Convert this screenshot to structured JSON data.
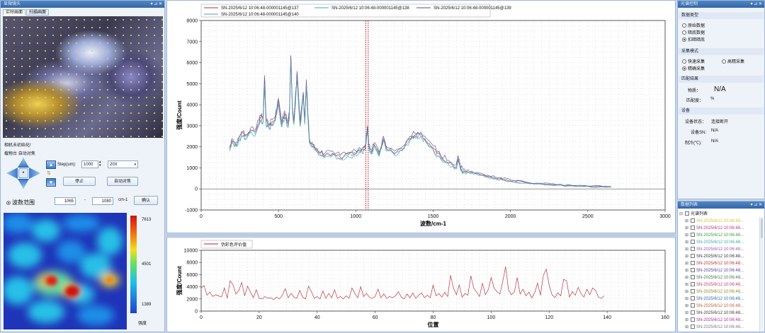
{
  "left": {
    "camera_title": "显微镜头",
    "tabs": [
      "实时画面",
      "扫描画面"
    ],
    "camera_status": "相机未初始化!",
    "stage_tabs": [
      "载物台",
      "自动对焦"
    ],
    "step_label": "Step(um):",
    "step_value": "1000",
    "objective": "20X",
    "stop_button": "停止",
    "autofocus_button": "自动对焦",
    "wave_range_label": "波数范围",
    "range_from": "1065",
    "range_sep": "-",
    "range_to": "1080",
    "range_unit": "cm-1",
    "confirm_button": "确认",
    "colorbar_max": "7613",
    "colorbar_mid": "4501",
    "colorbar_min": "1389",
    "colorbar_title": "强度"
  },
  "right": {
    "control_title": "光谱控制",
    "data_type_title": "数据类型",
    "data_types": [
      "原始数据",
      "暗底数据",
      "扣暗暗底"
    ],
    "acq_mode_title": "采集模式",
    "acq_modes": [
      "快速采集",
      "高精采集",
      "精确采集"
    ],
    "match_title": "匹配结果",
    "substance_label": "物质：",
    "substance_value": "N/A",
    "match_label": "匹配度：",
    "match_unit": "%",
    "device_title": "设备",
    "device_status_label": "设备状态：",
    "device_status_value": "连接断开",
    "device_sn_label": "设备SN:",
    "device_sn_value": "N/A",
    "cooling_label": "制冷(℃):",
    "cooling_value": "N/A",
    "list_title": "数据列表",
    "list_root": "光谱列表",
    "list_items": [
      "SN-2025/6/12 10:06:48...",
      "SN-2025/6/12 10:06:48...",
      "SN-2025/6/12 10:06:48...",
      "SN-2025/6/12 10:06:48...",
      "SN-2025/6/12 10:06:48...",
      "SN-2025/6/12 10:06:48...",
      "SN-2025/6/12 10:06:48...",
      "SN-2025/6/12 10:06:48...",
      "SN-2025/6/12 10:06:48...",
      "SN-2025/6/12 10:06:48...",
      "SN-2025/6/12 10:06:48...",
      "SN-2025/6/12 10:06:48...",
      "SN-2025/6/12 10:06:48...",
      "SN-2025/6/12 10:06:48...",
      "SN-2025/6/12 10:06:48...",
      "SN-2025/6/12 10:06:48..."
    ],
    "list_colors": [
      "#d8c23a",
      "#c0307a",
      "#3a9a3a",
      "#3aa8b0",
      "#9a5ab8",
      "#333333",
      "#c03030",
      "#5a3a9a",
      "#3a7a3a",
      "#c03a7a",
      "#8a8a2a",
      "#2a6ab0",
      "#c06030",
      "#3a3a3a",
      "#b03090",
      "#7a7a7a"
    ],
    "colors": {
      "titlebar": "#3a6fb0",
      "panel_bg": "#f3f6fb",
      "accent": "#c01818"
    }
  },
  "chart_data": [
    {
      "type": "line",
      "xlabel": "波数/cm-1",
      "ylabel": "强度/Count",
      "xlim": [
        0,
        3000
      ],
      "ylim": [
        -1000,
        8000
      ],
      "xticks": [
        0,
        500,
        1000,
        1500,
        2000,
        2500,
        3000
      ],
      "yticks": [
        -1000,
        0,
        1000,
        2000,
        3000,
        4000,
        5000,
        6000,
        7000,
        8000
      ],
      "vlines": [
        1065,
        1080
      ],
      "legend_position": "top",
      "grid": true,
      "series": [
        {
          "name": "SN-2025/6/12 10:06:48-000001145@137",
          "color": "#a8324a",
          "shift": 0,
          "x": [
            185,
            200,
            230,
            260,
            290,
            320,
            350,
            380,
            400,
            410,
            420,
            440,
            460,
            480,
            500,
            520,
            540,
            560,
            570,
            580,
            590,
            600,
            620,
            640,
            660,
            670,
            680,
            690,
            700,
            720,
            760,
            800,
            850,
            900,
            950,
            1000,
            1030,
            1060,
            1075,
            1085,
            1100,
            1120,
            1150,
            1180,
            1200,
            1250,
            1300,
            1350,
            1380,
            1420,
            1450,
            1500,
            1550,
            1600,
            1650,
            1660,
            1680,
            1700,
            1750,
            1800,
            1850,
            1900,
            1950,
            2000,
            2100,
            2200,
            2300,
            2400,
            2500,
            2600,
            2650
          ],
          "y": [
            1900,
            2300,
            2100,
            2600,
            2500,
            2800,
            2700,
            3400,
            3300,
            5200,
            3200,
            3000,
            3200,
            3400,
            4200,
            3100,
            3600,
            3100,
            3500,
            6300,
            3800,
            3200,
            5500,
            3100,
            4500,
            3200,
            5100,
            3500,
            2300,
            2100,
            1700,
            1600,
            1700,
            1500,
            1650,
            1700,
            1800,
            1950,
            2900,
            2000,
            1750,
            2100,
            1650,
            2400,
            1900,
            1700,
            1900,
            2400,
            2550,
            2600,
            2350,
            1950,
            1500,
            1250,
            1050,
            1500,
            900,
            850,
            800,
            700,
            600,
            520,
            450,
            380,
            300,
            240,
            190,
            160,
            130,
            110,
            100
          ]
        },
        {
          "name": "SN-2025/6/12 10:06:48-000001145@138",
          "color": "#3aa8b0",
          "shift": -150,
          "x": [
            185,
            200,
            230,
            260,
            290,
            320,
            350,
            380,
            400,
            410,
            420,
            440,
            460,
            480,
            500,
            520,
            540,
            560,
            570,
            580,
            590,
            600,
            620,
            640,
            660,
            670,
            680,
            690,
            700,
            720,
            760,
            800,
            850,
            900,
            950,
            1000,
            1030,
            1060,
            1075,
            1085,
            1100,
            1120,
            1150,
            1180,
            1200,
            1250,
            1300,
            1350,
            1380,
            1420,
            1450,
            1500,
            1550,
            1600,
            1650,
            1660,
            1680,
            1700,
            1750,
            1800,
            1850,
            1900,
            1950,
            2000,
            2100,
            2200,
            2300,
            2400,
            2500,
            2600,
            2650
          ],
          "y": [
            1800,
            2200,
            2000,
            2500,
            2350,
            2650,
            2550,
            3200,
            3100,
            4900,
            3000,
            2850,
            3050,
            3250,
            4000,
            2950,
            3400,
            2950,
            3300,
            6000,
            3600,
            3050,
            5200,
            2950,
            4300,
            3050,
            4900,
            3300,
            2200,
            2000,
            1600,
            1500,
            1600,
            1400,
            1550,
            1600,
            1700,
            1850,
            2750,
            1900,
            1650,
            2000,
            1550,
            2300,
            1800,
            1600,
            1800,
            2300,
            2450,
            2500,
            2250,
            1850,
            1400,
            1150,
            950,
            1400,
            850,
            800,
            750,
            650,
            560,
            480,
            420,
            350,
            280,
            220,
            170,
            140,
            120,
            100,
            90
          ]
        },
        {
          "name": "SN-2025/6/12 10:06:48-000001145@139",
          "color": "#5a4aa0",
          "shift": 100,
          "x": [
            185,
            200,
            230,
            260,
            290,
            320,
            350,
            380,
            400,
            410,
            420,
            440,
            460,
            480,
            500,
            520,
            540,
            560,
            570,
            580,
            590,
            600,
            620,
            640,
            660,
            670,
            680,
            690,
            700,
            720,
            760,
            800,
            850,
            900,
            950,
            1000,
            1030,
            1060,
            1075,
            1085,
            1100,
            1120,
            1150,
            1180,
            1200,
            1250,
            1300,
            1350,
            1380,
            1420,
            1450,
            1500,
            1550,
            1600,
            1650,
            1660,
            1680,
            1700,
            1750,
            1800,
            1850,
            1900,
            1950,
            2000,
            2100,
            2200,
            2300,
            2400,
            2500,
            2600,
            2650
          ],
          "y": [
            2000,
            2400,
            2200,
            2700,
            2600,
            2900,
            2800,
            3500,
            3400,
            5400,
            3300,
            3100,
            3300,
            3500,
            4300,
            3200,
            3700,
            3200,
            3600,
            6350,
            3900,
            3300,
            5600,
            3200,
            4600,
            3300,
            5200,
            3600,
            2400,
            2200,
            1800,
            1700,
            1800,
            1600,
            1750,
            1800,
            1900,
            2050,
            3000,
            2100,
            1850,
            2200,
            1750,
            2500,
            2000,
            1800,
            2000,
            2500,
            2650,
            2700,
            2450,
            2050,
            1600,
            1350,
            1150,
            1600,
            1000,
            950,
            850,
            750,
            650,
            570,
            500,
            420,
            330,
            260,
            210,
            170,
            140,
            120,
            110
          ]
        },
        {
          "name": "SN-2025/6/12 10:06:48-000001145@140",
          "color": "#5a9aa8",
          "shift": -80,
          "x": [
            185,
            200,
            230,
            260,
            290,
            320,
            350,
            380,
            400,
            410,
            420,
            440,
            460,
            480,
            500,
            520,
            540,
            560,
            570,
            580,
            590,
            600,
            620,
            640,
            660,
            670,
            680,
            690,
            700,
            720,
            760,
            800,
            850,
            900,
            950,
            1000,
            1030,
            1060,
            1075,
            1085,
            1100,
            1120,
            1150,
            1180,
            1200,
            1250,
            1300,
            1350,
            1380,
            1420,
            1450,
            1500,
            1550,
            1600,
            1650,
            1660,
            1680,
            1700,
            1750,
            1800,
            1850,
            1900,
            1950,
            2000,
            2100,
            2200,
            2300,
            2400,
            2500,
            2600,
            2650
          ],
          "y": [
            1850,
            2250,
            2050,
            2550,
            2400,
            2700,
            2600,
            3300,
            3200,
            5000,
            3100,
            2900,
            3100,
            3300,
            4100,
            3000,
            3500,
            3000,
            3400,
            6100,
            3700,
            3100,
            5300,
            3000,
            4400,
            3100,
            5000,
            3400,
            2250,
            2050,
            1650,
            1550,
            1650,
            1450,
            1600,
            1650,
            1750,
            1900,
            2800,
            1950,
            1700,
            2050,
            1600,
            2350,
            1850,
            1650,
            1850,
            2350,
            2500,
            2550,
            2300,
            1900,
            1450,
            1200,
            1000,
            1450,
            870,
            820,
            770,
            680,
            580,
            500,
            430,
            360,
            290,
            230,
            180,
            150,
            125,
            105,
            95
          ]
        }
      ]
    },
    {
      "type": "line",
      "xlabel": "位置",
      "ylabel": "强度/Count",
      "xlim": [
        0,
        160
      ],
      "ylim": [
        0,
        10000
      ],
      "xticks": [
        0,
        20,
        40,
        60,
        80,
        100,
        120,
        140,
        160
      ],
      "yticks": [
        0,
        2000,
        4000,
        6000,
        8000,
        10000
      ],
      "legend_position": "top-left",
      "grid": true,
      "series": [
        {
          "name": "伪彩色评价值",
          "color": "#b02030",
          "x": [
            0,
            1,
            2,
            3,
            4,
            5,
            6,
            7,
            8,
            9,
            10,
            11,
            12,
            13,
            14,
            15,
            16,
            17,
            18,
            19,
            20,
            21,
            22,
            23,
            24,
            25,
            26,
            27,
            28,
            29,
            30,
            31,
            32,
            33,
            34,
            35,
            36,
            37,
            38,
            39,
            40,
            41,
            42,
            43,
            44,
            45,
            46,
            47,
            48,
            49,
            50,
            51,
            52,
            53,
            54,
            55,
            56,
            57,
            58,
            59,
            60,
            61,
            62,
            63,
            64,
            65,
            66,
            67,
            68,
            69,
            70,
            71,
            72,
            73,
            74,
            75,
            76,
            77,
            78,
            79,
            80,
            81,
            82,
            83,
            84,
            85,
            86,
            87,
            88,
            89,
            90,
            91,
            92,
            93,
            94,
            95,
            96,
            97,
            98,
            99,
            100,
            101,
            102,
            103,
            104,
            105,
            106,
            107,
            108,
            109,
            110,
            111,
            112,
            113,
            114,
            115,
            116,
            117,
            118,
            119,
            120,
            121,
            122,
            123,
            124,
            125,
            126,
            127,
            128,
            129,
            130,
            131,
            132,
            133,
            134,
            135,
            136,
            137,
            138,
            139
          ],
          "y": [
            3800,
            4200,
            2600,
            3100,
            2400,
            2700,
            2500,
            2300,
            3800,
            2100,
            5000,
            4300,
            2800,
            3400,
            4700,
            2500,
            4100,
            3100,
            2200,
            3500,
            2100,
            2000,
            2400,
            2100,
            2200,
            1900,
            2300,
            2000,
            2600,
            3700,
            2200,
            2900,
            2300,
            2100,
            3400,
            2300,
            2000,
            4100,
            3200,
            2100,
            2400,
            2000,
            3300,
            2100,
            2900,
            2200,
            3500,
            2100,
            2400,
            2000,
            2500,
            2100,
            3800,
            2900,
            2200,
            4000,
            2400,
            2900,
            2300,
            2100,
            2400,
            3600,
            2200,
            2800,
            2100,
            2400,
            2200,
            2500,
            3200,
            2300,
            2000,
            2800,
            2200,
            3000,
            2100,
            2600,
            3000,
            2200,
            2600,
            2200,
            4300,
            2500,
            2900,
            2300,
            3100,
            2400,
            5900,
            3800,
            2700,
            4300,
            2300,
            2900,
            2600,
            5800,
            3800,
            3100,
            2400,
            4600,
            2700,
            3500,
            5500,
            3800,
            3200,
            2800,
            4900,
            7300,
            3500,
            2700,
            3100,
            5500,
            2800,
            3600,
            2500,
            3100,
            2200,
            3000,
            4600,
            2600,
            5900,
            6900,
            4300,
            2700,
            2200,
            3000,
            2500,
            5200,
            5000,
            2300,
            3200,
            2600,
            3900,
            2900,
            2300,
            3600,
            2700,
            3800,
            3400,
            2300,
            2100,
            2500
          ]
        }
      ]
    }
  ]
}
